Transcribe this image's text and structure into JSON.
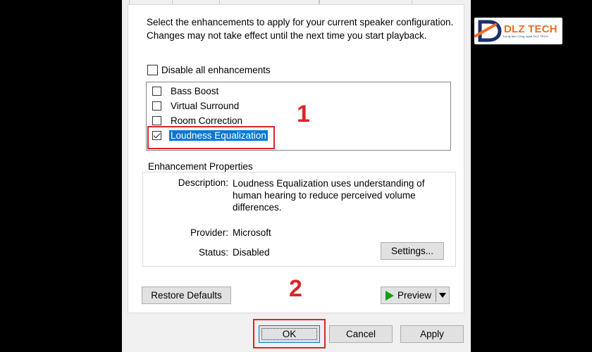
{
  "instructions": "Select the enhancements to apply for your current speaker configuration. Changes may not take effect until the next time you start playback.",
  "disable_all": {
    "label": "Disable all enhancements",
    "checked": false
  },
  "enhancements": [
    {
      "label": "Bass Boost",
      "checked": false
    },
    {
      "label": "Virtual Surround",
      "checked": false
    },
    {
      "label": "Room Correction",
      "checked": false
    },
    {
      "label": "Loudness Equalization",
      "checked": true
    }
  ],
  "properties": {
    "title": "Enhancement Properties",
    "description_label": "Description:",
    "description": "Loudness Equalization uses understanding of human hearing to reduce perceived volume differences.",
    "provider_label": "Provider:",
    "provider": "Microsoft",
    "status_label": "Status:",
    "status": "Disabled",
    "settings_button": "Settings..."
  },
  "buttons": {
    "restore_defaults": "Restore Defaults",
    "preview": "Preview",
    "ok": "OK",
    "cancel": "Cancel",
    "apply": "Apply"
  },
  "annotations": {
    "step1": "1",
    "step2": "2"
  },
  "logo": {
    "brand": "DLZ TECH",
    "tagline": "Trung tâm Công nghệ DLZ TECH"
  },
  "colors": {
    "selection": "#0078d7",
    "annotation": "#d9262a",
    "logo_orange": "#f26a21",
    "logo_navy": "#1b2f6b"
  }
}
